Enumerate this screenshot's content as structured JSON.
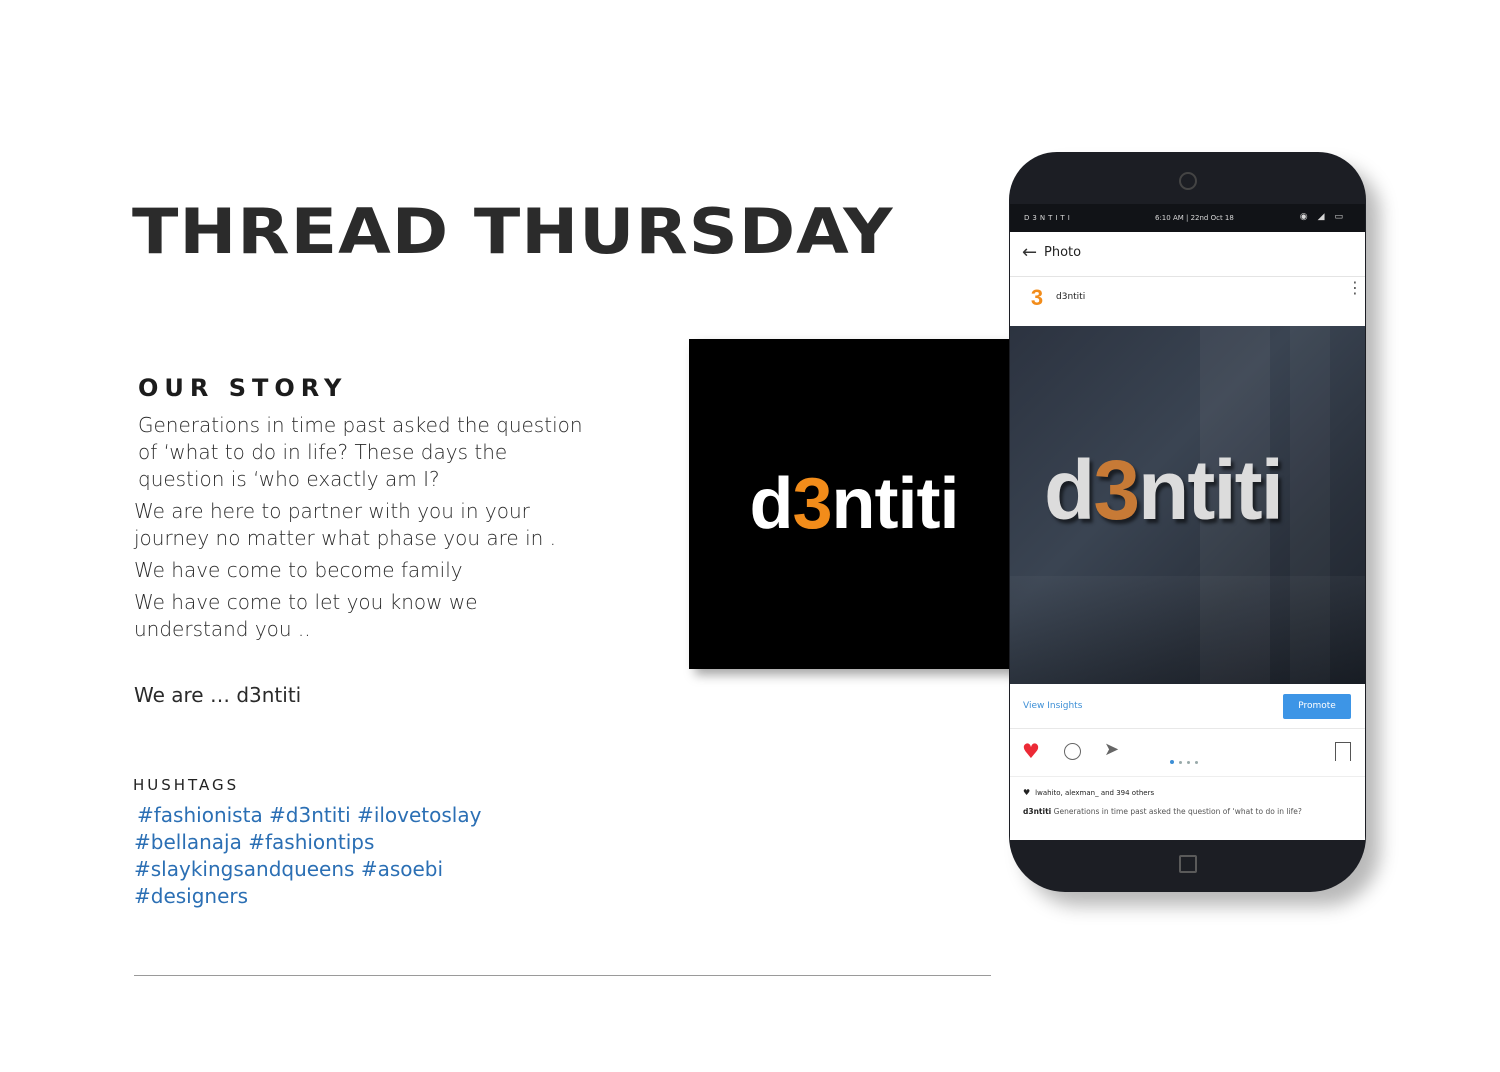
{
  "title": "THREAD THURSDAY",
  "story": {
    "heading": "OUR STORY",
    "paragraphs": [
      "Generations in time past asked the question of ‘what to do in life? These days the question is ‘who exactly am I?",
      "We are here to partner with you in your journey no matter what phase you are in .",
      "We have come to become family",
      "We have come to let you know we understand you .."
    ],
    "closing": "We are … d3ntiti"
  },
  "hashtags": {
    "heading": "HUSHTAGS",
    "lines": [
      "#fashionista #d3ntiti #ilovetoslay",
      "#bellanaja #fashiontips",
      "#slaykingsandqueens #asoebi",
      "#designers"
    ]
  },
  "logo": {
    "prefix": "d",
    "accent": "3",
    "suffix": "ntiti",
    "accent_color": "#f28c1a"
  },
  "phone": {
    "status_brand": "D3NTITI",
    "status_time": "6:10 AM | 22nd Oct 18",
    "appbar_title": "Photo",
    "username": "d3ntiti",
    "avatar_glyph": "3",
    "wall_logo": {
      "prefix": "d",
      "accent": "3",
      "suffix": "ntiti"
    },
    "view_insights": "View Insights",
    "promote": "Promote",
    "likes": "lwahito, alexman_ and 394 others",
    "caption_user": "d3ntiti",
    "caption_text": "Generations in time past asked the question of ‘what to do in life?",
    "icons": [
      "back-arrow-icon",
      "more-vertical-icon",
      "heart-icon",
      "comment-icon",
      "share-icon",
      "bookmark-icon"
    ]
  },
  "colors": {
    "hashtag": "#2b6fb4",
    "brand_orange": "#f28c1a",
    "like_red": "#ec2a36",
    "promote_blue": "#3d95e6"
  }
}
